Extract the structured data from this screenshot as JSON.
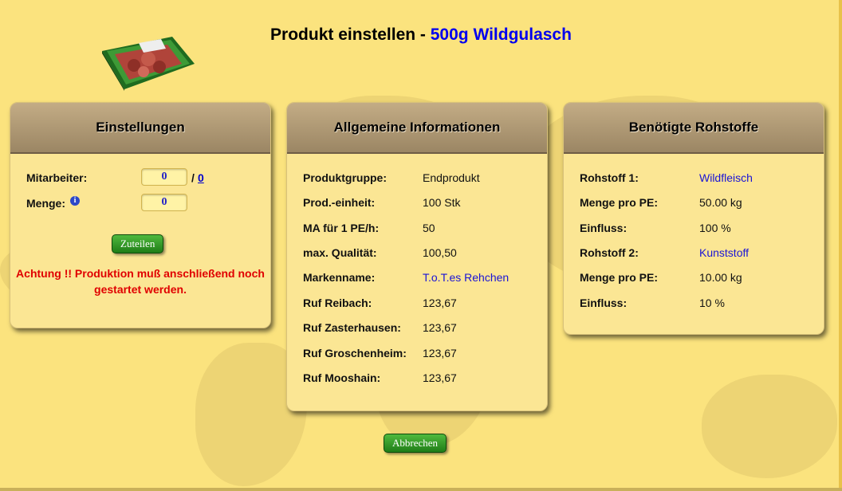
{
  "title": {
    "prefix": "Produkt einstellen - ",
    "product": "500g Wildgulasch"
  },
  "product_image": {
    "pack_label": "Wildgulasch 500g"
  },
  "einstellungen": {
    "heading": "Einstellungen",
    "mitarbeiter_label": "Mitarbeiter:",
    "mitarbeiter_value": "0",
    "mitarbeiter_sep": "/",
    "mitarbeiter_max": "0",
    "menge_label": "Menge:",
    "menge_value": "0",
    "info_glyph": "i",
    "assign_button": "Zuteilen",
    "warning": "Achtung !! Produktion muß anschließend noch gestartet werden."
  },
  "allgemein": {
    "heading": "Allgemeine Informationen",
    "rows": [
      {
        "label": "Produktgruppe:",
        "value": "Endprodukt"
      },
      {
        "label": "Prod.-einheit:",
        "value": "100 Stk"
      },
      {
        "label": "MA für 1 PE/h:",
        "value": "50"
      },
      {
        "label": "max. Qualität:",
        "value": "100,50"
      },
      {
        "label": "Markenname:",
        "value": "T.o.T.es Rehchen"
      },
      {
        "label": "Ruf Reibach:",
        "value": "123,67"
      },
      {
        "label": "Ruf Zasterhausen:",
        "value": "123,67"
      },
      {
        "label": "Ruf Groschenheim:",
        "value": "123,67"
      },
      {
        "label": "Ruf Mooshain:",
        "value": "123,67"
      }
    ]
  },
  "rohstoffe": {
    "heading": "Benötigte Rohstoffe",
    "rows": [
      {
        "label": "Rohstoff 1:",
        "value": "Wildfleisch"
      },
      {
        "label": "Menge pro PE:",
        "value": "50.00 kg"
      },
      {
        "label": "Einfluss:",
        "value": "100 %"
      },
      {
        "label": "Rohstoff 2:",
        "value": "Kunststoff"
      },
      {
        "label": "Menge pro PE:",
        "value": "10.00 kg"
      },
      {
        "label": "Einfluss:",
        "value": "10 %"
      }
    ]
  },
  "cancel_button": "Abbrechen",
  "colors": {
    "background": "#fbe37e",
    "link": "#1a14d6",
    "warning": "#e00000",
    "button": "#1f7d17"
  }
}
